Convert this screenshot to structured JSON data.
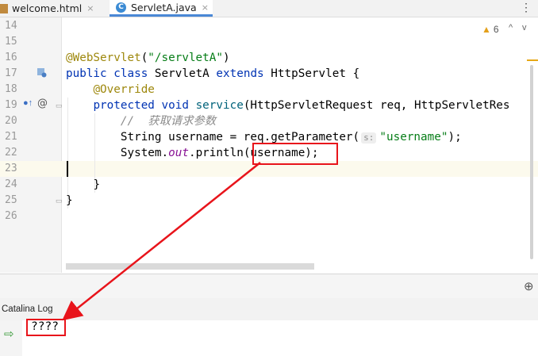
{
  "tabs": [
    {
      "label": "welcome.html",
      "close": "×",
      "active": false
    },
    {
      "label": "ServletA.java",
      "close": "×",
      "active": true,
      "icon_letter": "C"
    }
  ],
  "more_menu": "⋮",
  "inspection": {
    "warnings": "6",
    "up": "^",
    "down": "v"
  },
  "editor": {
    "line_numbers": [
      "14",
      "15",
      "16",
      "17",
      "18",
      "19",
      "20",
      "21",
      "22",
      "23",
      "24",
      "25",
      "26"
    ],
    "lines": {
      "l16": {
        "ann": "@WebServlet",
        "p1": "(",
        "str": "\"/servletA\"",
        "p2": ")"
      },
      "l17": {
        "kw1": "public",
        "kw2": "class",
        "name": "ServletA",
        "kw3": "extends",
        "sup": "HttpServlet",
        "brace": "{"
      },
      "l18": {
        "ann": "@Override"
      },
      "l19": {
        "kw1": "protected",
        "kw2": "void",
        "fn": "service",
        "rest": "(HttpServletRequest req, HttpServletRes"
      },
      "l20": {
        "comment": "//  获取请求参数"
      },
      "l21": {
        "pre": "String username = req.getParameter(",
        "hint": "s:",
        "str": "\"username\"",
        "post": ");"
      },
      "l22": {
        "pre": "System.",
        "field": "out",
        "post": ".println(username);"
      },
      "l24": {
        "brace": "}"
      },
      "l25": {
        "brace": "}"
      }
    }
  },
  "bottom_panel": {
    "title": "Catalina Log",
    "output": "????"
  },
  "colors": {
    "annotation_box": "#e8141b",
    "keyword": "#0033b3",
    "string": "#067d17",
    "annotation": "#9e880d"
  }
}
